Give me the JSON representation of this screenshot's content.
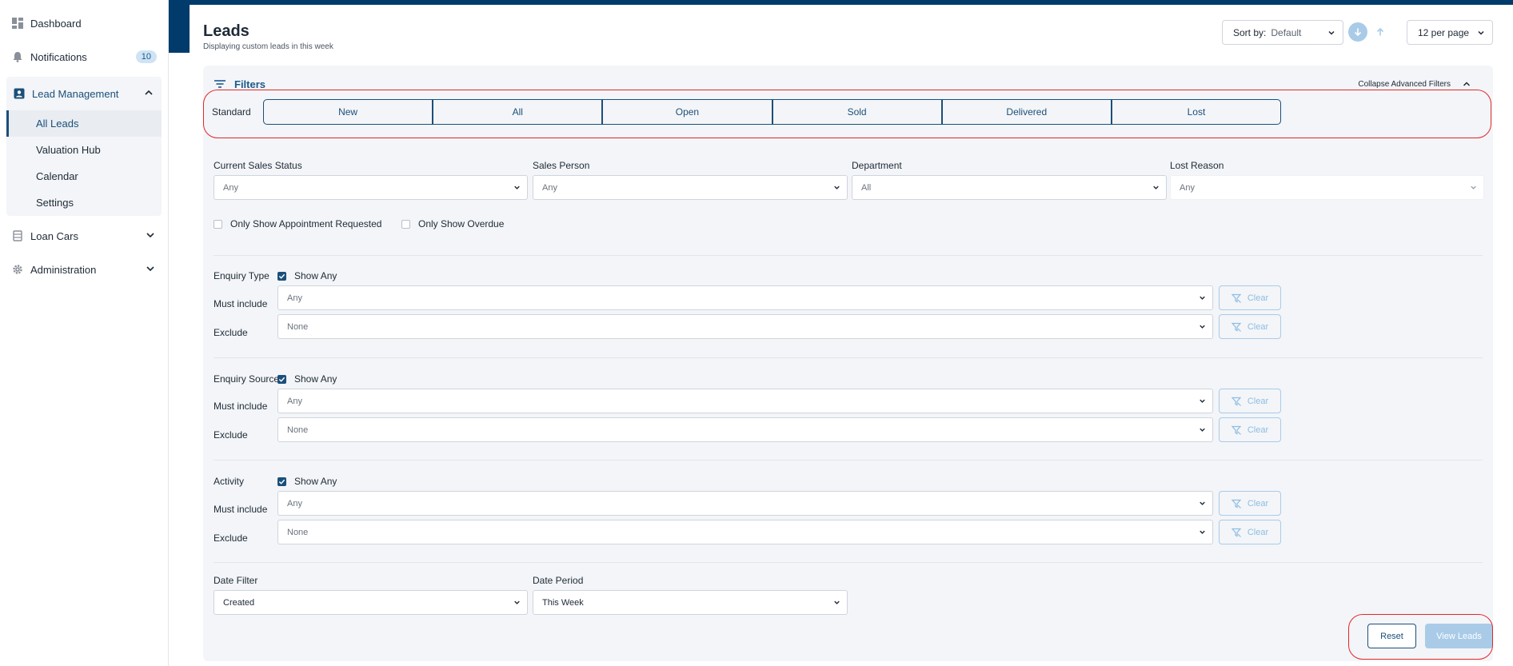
{
  "sidebar": {
    "items": [
      {
        "label": "Dashboard",
        "icon": "dashboard-icon"
      },
      {
        "label": "Notifications",
        "icon": "bell-icon",
        "badge": "10"
      },
      {
        "label": "Lead Management",
        "icon": "contact-card-icon"
      },
      {
        "label": "Loan Cars",
        "icon": "car-icon"
      },
      {
        "label": "Administration",
        "icon": "gear-icon"
      }
    ],
    "sub_items": [
      "All Leads",
      "Valuation Hub",
      "Calendar",
      "Settings"
    ],
    "active_sub": "All Leads"
  },
  "header": {
    "title": "Leads",
    "subtitle": "Displaying custom leads in this week",
    "sort_label": "Sort by:",
    "sort_value": "Default",
    "per_page": "12 per page"
  },
  "filters": {
    "title": "Filters",
    "collapse_label": "Collapse Advanced Filters",
    "standard_label": "Standard",
    "standard_tabs": [
      "New",
      "All",
      "Open",
      "Sold",
      "Delivered",
      "Lost"
    ],
    "dropdowns": [
      {
        "label": "Current Sales Status",
        "value": "Any"
      },
      {
        "label": "Sales Person",
        "value": "Any"
      },
      {
        "label": "Department",
        "value": "All"
      },
      {
        "label": "Lost Reason",
        "value": "Any"
      }
    ],
    "checkboxes": [
      "Only Show Appointment Requested",
      "Only Show Overdue"
    ],
    "groups": [
      {
        "title": "Enquiry Type",
        "show_any": "Show Any",
        "must_label": "Must include",
        "must_value": "Any",
        "exclude_label": "Exclude",
        "exclude_value": "None"
      },
      {
        "title": "Enquiry Source",
        "show_any": "Show Any",
        "must_label": "Must include",
        "must_value": "Any",
        "exclude_label": "Exclude",
        "exclude_value": "None"
      },
      {
        "title": "Activity",
        "show_any": "Show Any",
        "must_label": "Must include",
        "must_value": "Any",
        "exclude_label": "Exclude",
        "exclude_value": "None"
      }
    ],
    "clear_label": "Clear",
    "date_filter": {
      "label": "Date Filter",
      "value": "Created"
    },
    "date_period": {
      "label": "Date Period",
      "value": "This Week"
    },
    "reset_label": "Reset",
    "view_label": "View Leads"
  },
  "colors": {
    "primary": "#1b4f7a",
    "accent_light": "#a9cbe8",
    "highlight": "#e3262b",
    "band": "#003b6b"
  }
}
